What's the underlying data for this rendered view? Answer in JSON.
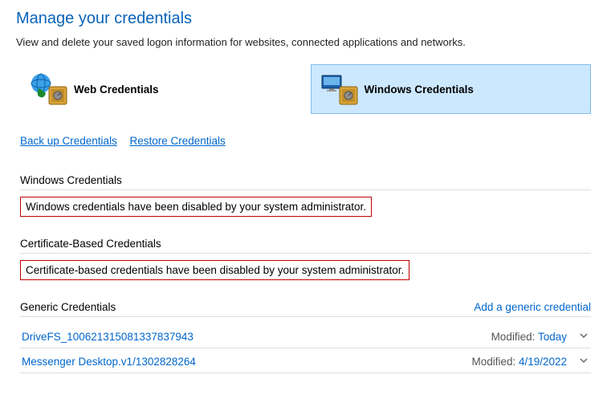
{
  "title": "Manage your credentials",
  "subtitle": "View and delete your saved logon information for websites, connected applications and networks.",
  "tabs": {
    "web": {
      "label": "Web Credentials"
    },
    "windows": {
      "label": "Windows Credentials"
    }
  },
  "links": {
    "backup": "Back up Credentials",
    "restore": "Restore Credentials"
  },
  "sections": {
    "windows": {
      "header": "Windows Credentials",
      "message": "Windows credentials have been disabled by your system administrator."
    },
    "certificate": {
      "header": "Certificate-Based Credentials",
      "message": "Certificate-based credentials have been disabled by your system administrator."
    },
    "generic": {
      "header": "Generic Credentials",
      "action": "Add a generic credential",
      "items": [
        {
          "name": "DriveFS_100621315081337837943",
          "modified_label": "Modified:",
          "modified_value": "Today"
        },
        {
          "name": "Messenger Desktop.v1/1302828264",
          "modified_label": "Modified:",
          "modified_value": "4/19/2022"
        }
      ]
    }
  }
}
